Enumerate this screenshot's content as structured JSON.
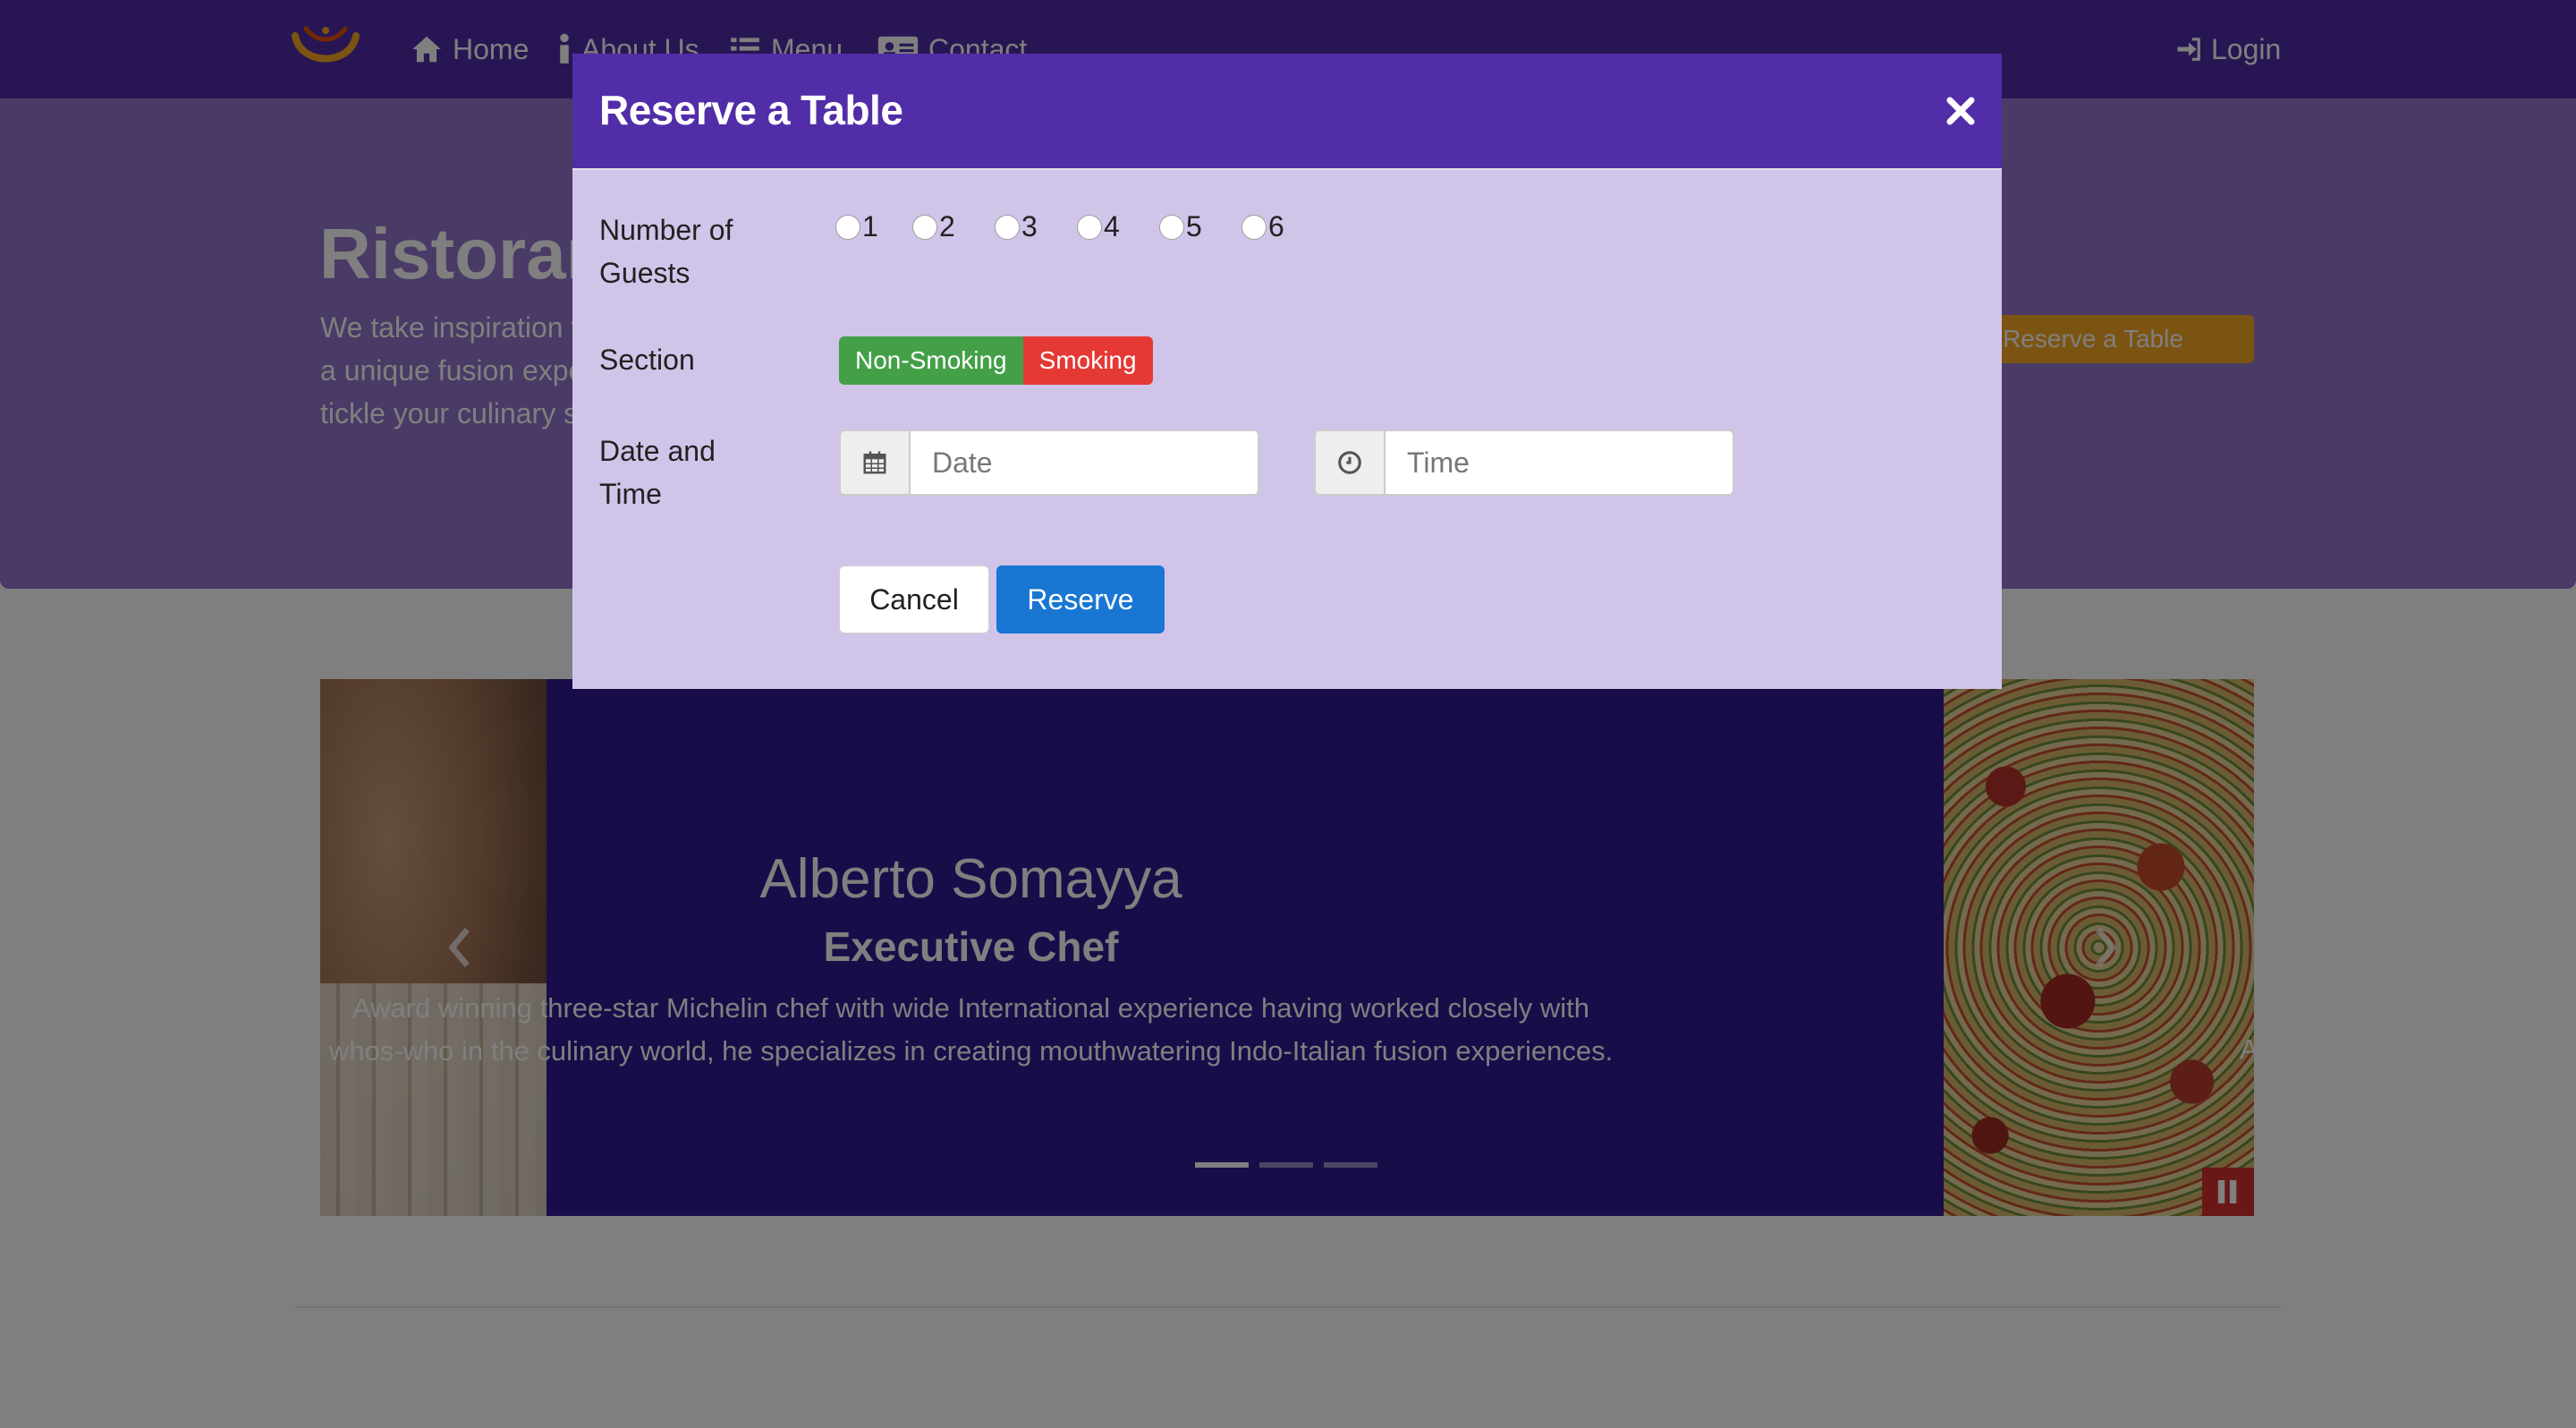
{
  "navbar": {
    "logo_icon": "restaurant-logo",
    "items": [
      {
        "label": "Home",
        "icon": "home-icon"
      },
      {
        "label": "About Us",
        "icon": "info-icon"
      },
      {
        "label": "Menu",
        "icon": "list-icon"
      },
      {
        "label": "Contact",
        "icon": "address-card-icon"
      }
    ],
    "login": {
      "label": "Login",
      "icon": "sign-in-icon"
    }
  },
  "jumbotron": {
    "title": "Ristorante con Fusion",
    "text": "We take inspiration from the World's best cuisines, and create a unique fusion experience. Our lipsmacking creations will tickle your culinary senses!",
    "reserve_button": "Reserve a Table"
  },
  "carousel": {
    "slides": [
      {
        "name": "Alberto Somayya",
        "designation": "Executive Chef",
        "description": "Award winning three-star Michelin chef with wide International experience having worked closely with whos-who in the culinary world, he specializes in creating mouthwatering Indo-Italian fusion experiences."
      }
    ],
    "peek_text": "A",
    "active_indicator": 0,
    "indicator_count": 3
  },
  "modal": {
    "title": "Reserve a Table",
    "close_icon": "close-icon",
    "guests_label": "Number of Guests",
    "guest_options": [
      "1",
      "2",
      "3",
      "4",
      "5",
      "6"
    ],
    "section_label": "Section",
    "section_options": [
      "Non-Smoking",
      "Smoking"
    ],
    "datetime_label": "Date and Time",
    "date_placeholder": "Date",
    "time_placeholder": "Time",
    "date_icon": "calendar-icon",
    "time_icon": "clock-icon",
    "cancel_label": "Cancel",
    "reserve_label": "Reserve"
  },
  "colors": {
    "primary": "#512da8",
    "jumbotron": "#9575cd",
    "modal_body": "#d1c4e9",
    "carousel_bg": "#311b92",
    "reserve_button": "#1976d2",
    "non_smoking": "#43a047",
    "smoking": "#e53935",
    "warning": "#f9a825"
  }
}
